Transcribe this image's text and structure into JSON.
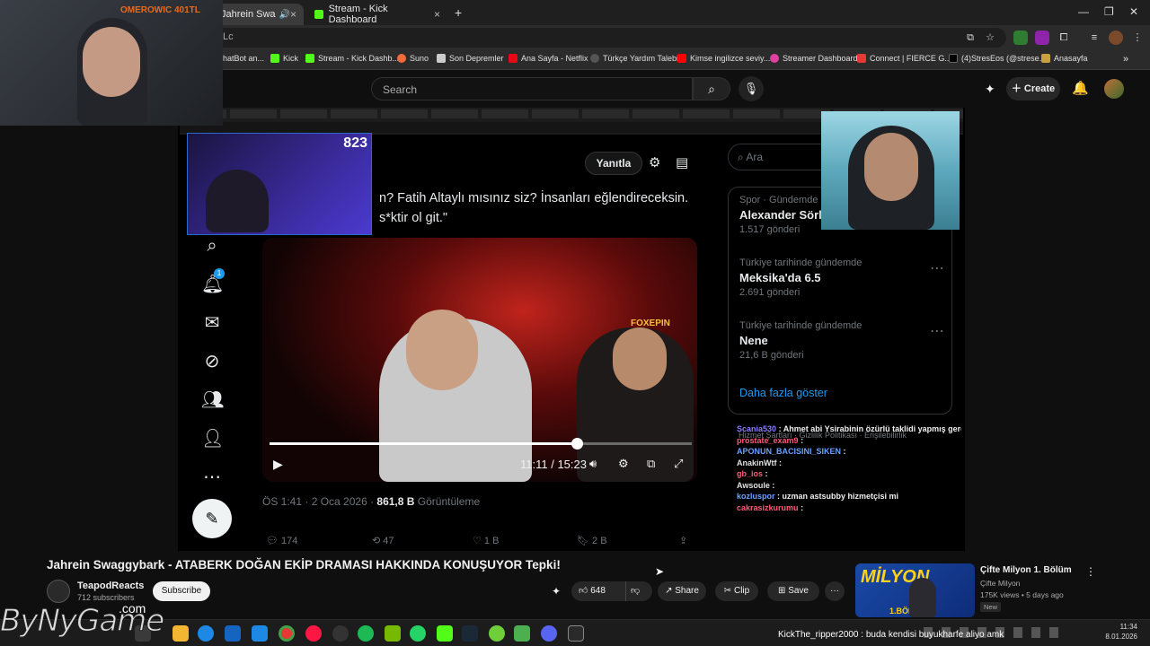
{
  "browser": {
    "tabs": [
      {
        "label": "Jahrein Swaggybark - ATABE"
      },
      {
        "label": "Stream - Kick Dashboard"
      }
    ],
    "new_tab_symbol": "+",
    "omnibox_text": "Lc",
    "bookmarks": [
      {
        "label": "hatBot an...",
        "color": "#888888"
      },
      {
        "label": "Kick",
        "color": "#53fc18"
      },
      {
        "label": "Stream - Kick Dashb...",
        "color": "#53fc18"
      },
      {
        "label": "Suno",
        "color": "#f26b3a"
      },
      {
        "label": "Son Depremler",
        "color": "#cccccc"
      },
      {
        "label": "Ana Sayfa - Netflix",
        "color": "#e50914"
      },
      {
        "label": "Türkçe Yardım Talebi",
        "color": "#555555"
      },
      {
        "label": "Kimse ingilizce seviy...",
        "color": "#ff0000"
      },
      {
        "label": "Streamer Dashboard",
        "color": "#e040a0"
      },
      {
        "label": "Connect | FIERCE G...",
        "color": "#e53935"
      },
      {
        "label": "(4)StresEos (@strese...",
        "color": "#000000"
      },
      {
        "label": "Anasayfa",
        "color": "#c8a040"
      }
    ]
  },
  "overlay": {
    "streamer_label": "OMEROWIC 401TL",
    "viewer_count": "823"
  },
  "youtube": {
    "search_placeholder": "Search",
    "create_label": "Create",
    "video_title": "Jahrein Swaggybark - ATABERK DOĞAN EKİP DRAMASI HAKKINDA KONUŞUYOR Tepki!",
    "channel_name": "TeapodReacts",
    "subscribers": "712 subscribers",
    "subscribe_label": "Subscribe",
    "likes": "648",
    "share_label": "Share",
    "clip_label": "Clip",
    "save_label": "Save",
    "more_label": "···"
  },
  "inner": {
    "reply_label": "Yanıtla",
    "search_placeholder": "Ara",
    "notification_badge": "1",
    "post_lines": [
      "n? Fatih Altaylı mısınız siz? İnsanları eğlendireceksin.",
      "s*ktir ol git.\""
    ],
    "video_time": "11:11 / 15:23",
    "video_badge": "FOXEPIN",
    "post_meta_time": "ÖS 1:41 · 2 Oca 2026 · ",
    "post_meta_views": "861,8 B",
    "post_meta_views_label": " Görüntüleme",
    "actions": {
      "replies": "174",
      "reposts": "47",
      "likes": "1 B",
      "bookmarks": "2 B"
    },
    "trends": [
      {
        "category": "Spor · Gündemde",
        "name": "Alexander Sörl",
        "count": "1.517 gönderi"
      },
      {
        "category": "Türkiye tarihinde gündemde",
        "name": "Meksika'da 6.5",
        "count": "2.691 gönderi"
      },
      {
        "category": "Türkiye tarihinde gündemde",
        "name": "Nene",
        "count": "21,6 B gönderi"
      }
    ],
    "show_more": "Daha fazla göster",
    "footer_links": [
      "Hizmet Şartları",
      "Gizlilik Politikası",
      "Erişilebilirlik"
    ]
  },
  "chat": [
    {
      "user": "Scania530",
      "color": "#8a7dff",
      "message": ": Ahmet abi Ysirabinin özürlü taklidi yapmış gerçek mi?"
    },
    {
      "user": "prostate_exam9",
      "color": "#ff5a7a",
      "message": ":"
    },
    {
      "user": "APONUN_BACISINI_SIKEN",
      "color": "#6aa0ff",
      "message": ":"
    },
    {
      "user": "AnakinWtf",
      "color": "#e0e0e0",
      "message": ":"
    },
    {
      "user": "gb_ios",
      "color": "#ff5a7a",
      "message": ":"
    },
    {
      "user": "Awsoule",
      "color": "#e0e0e0",
      "message": ":"
    },
    {
      "user": "kozluspor",
      "color": "#6aa0ff",
      "message": ": uzman astsubby hizmetçisi mi"
    },
    {
      "user": "cakrasizkurumu",
      "color": "#ff5a7a",
      "message": ":"
    }
  ],
  "recommended": {
    "title": "Çifte Milyon 1. Bölüm",
    "channel": "Çifte Milyon",
    "stats": "175K views • 5 days ago",
    "badge": "New",
    "thumb_text": "MİLYON",
    "thumb_sub": "1.BÖLÜM"
  },
  "taskbar": {
    "time": "11:34",
    "date": "8.01.2026",
    "ticker": "KickThe_ripper2000 : buda kendisi buyukharfe aliyo amk"
  },
  "watermark": {
    "text": "ByNyGame",
    "suffix": ".com"
  }
}
